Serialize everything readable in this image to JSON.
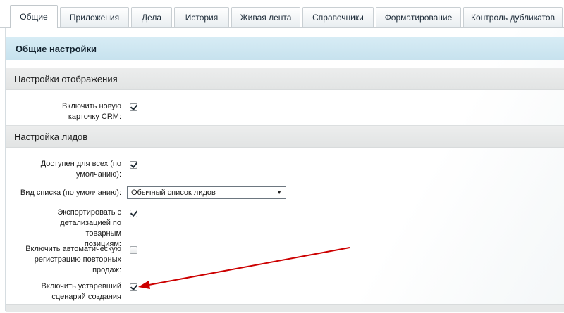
{
  "tabs": [
    {
      "label": "Общие",
      "active": true
    },
    {
      "label": "Приложения"
    },
    {
      "label": "Дела"
    },
    {
      "label": "История"
    },
    {
      "label": "Живая лента"
    },
    {
      "label": "Справочники"
    },
    {
      "label": "Форматирование"
    },
    {
      "label": "Контроль дубликатов"
    }
  ],
  "general_header": "Общие настройки",
  "display_section": {
    "title": "Настройки отображения",
    "new_card": {
      "label": "Включить новую карточку CRM:",
      "checked": true
    }
  },
  "leads_section": {
    "title": "Настройка лидов",
    "available_all": {
      "label": "Доступен для всех (по умолчанию):",
      "checked": true
    },
    "list_view": {
      "label": "Вид списка (по умолчанию):",
      "value": "Обычный список лидов"
    },
    "export_detail": {
      "label": "Экспортировать с детализацией по товарным позициям:",
      "checked": true
    },
    "auto_repeat": {
      "label": "Включить автоматическую регистрацию повторных продаж:",
      "checked": false
    },
    "legacy_scenario": {
      "label": "Включить устаревший сценарий создания лидов:",
      "checked": true
    }
  },
  "colors": {
    "accent_header": "#c7e2ee",
    "annotation_arrow": "#cc0000"
  }
}
